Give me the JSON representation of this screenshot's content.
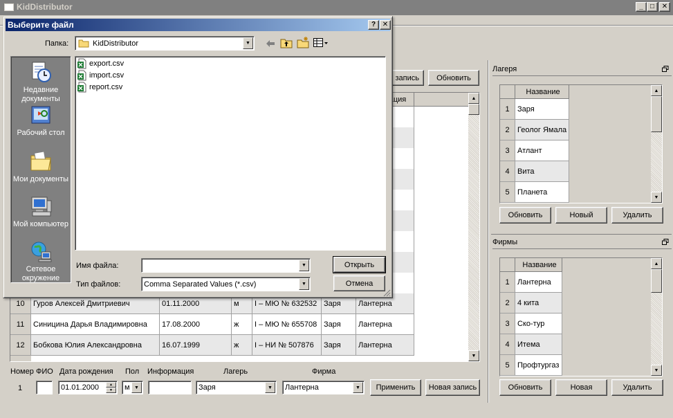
{
  "app": {
    "title": "KidDistributor"
  },
  "main": {
    "top_buttons": {
      "delete_record": "ь запись",
      "refresh": "Обновить"
    },
    "column_partial": "ация",
    "rows": [
      {
        "num": "10",
        "name": "Гуров Алексей Дмитриевич",
        "dob": "01.11.2000",
        "sex": "м",
        "doc": "I – МЮ № 632532",
        "camp": "Заря",
        "firm": "Лантерна"
      },
      {
        "num": "11",
        "name": "Синицина Дарья Владимировна",
        "dob": "17.08.2000",
        "sex": "ж",
        "doc": "I – МЮ № 655708",
        "camp": "Заря",
        "firm": "Лантерна"
      },
      {
        "num": "12",
        "name": "Бобкова Юлия Александровна",
        "dob": "16.07.1999",
        "sex": "ж",
        "doc": "I – НИ № 507876",
        "camp": "Заря",
        "firm": "Лантерна"
      }
    ]
  },
  "form": {
    "labels": {
      "num": "Номер",
      "fio": "ФИО",
      "dob": "Дата рождения",
      "sex": "Пол",
      "info": "Информация",
      "camp": "Лагерь",
      "firm": "Фирма"
    },
    "values": {
      "num": "1",
      "fio": "",
      "dob": "01.01.2000",
      "sex": "м",
      "info": "",
      "camp": "Заря",
      "firm": "Лантерна"
    },
    "apply": "Применить",
    "new_record": "Новая запись"
  },
  "camps": {
    "title": "Лагеря",
    "column": "Название",
    "items": [
      {
        "n": "1",
        "name": "Заря"
      },
      {
        "n": "2",
        "name": "Геолог Ямала"
      },
      {
        "n": "3",
        "name": "Атлант"
      },
      {
        "n": "4",
        "name": "Вита"
      },
      {
        "n": "5",
        "name": "Планета"
      }
    ],
    "buttons": {
      "refresh": "Обновить",
      "new": "Новый",
      "delete": "Удалить"
    }
  },
  "firms": {
    "title": "Фирмы",
    "column": "Название",
    "items": [
      {
        "n": "1",
        "name": "Лантерна"
      },
      {
        "n": "2",
        "name": "4 кита"
      },
      {
        "n": "3",
        "name": "Ско-тур"
      },
      {
        "n": "4",
        "name": "Итема"
      },
      {
        "n": "5",
        "name": "Профтургаз"
      }
    ],
    "buttons": {
      "refresh": "Обновить",
      "new": "Новая",
      "delete": "Удалить"
    }
  },
  "dialog": {
    "title": "Выберите файл",
    "help": "?",
    "close": "✕",
    "folder_label": "Папка:",
    "folder_value": "KidDistributor",
    "places": [
      {
        "label": "Недавние документы",
        "icon": "recent-documents-icon"
      },
      {
        "label": "Рабочий стол",
        "icon": "desktop-icon"
      },
      {
        "label": "Мои документы",
        "icon": "my-documents-icon"
      },
      {
        "label": "Мой компьютер",
        "icon": "my-computer-icon"
      },
      {
        "label": "Сетевое окружение",
        "icon": "network-icon"
      }
    ],
    "files": [
      "export.csv",
      "import.csv",
      "report.csv"
    ],
    "filename_label": "Имя файла:",
    "filename_value": "",
    "filetype_label": "Тип файлов:",
    "filetype_value": "Comma Separated Values (*.csv)",
    "open": "Открыть",
    "cancel": "Отмена"
  }
}
